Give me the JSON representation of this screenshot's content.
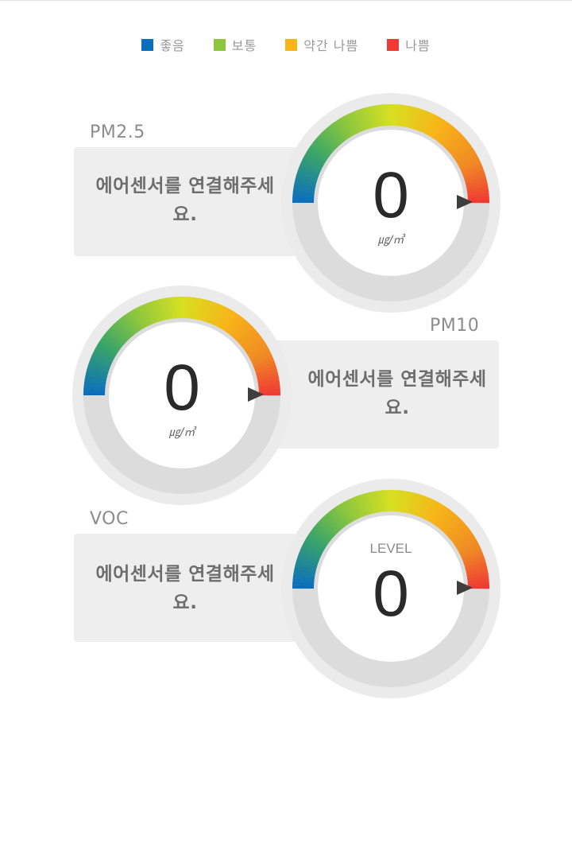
{
  "legend": [
    {
      "label": "좋음",
      "color": "#0a6ebd"
    },
    {
      "label": "보통",
      "color": "#8cc63e"
    },
    {
      "label": "약간 나쁨",
      "color": "#f8b418"
    },
    {
      "label": "나쁨",
      "color": "#ef3b33"
    }
  ],
  "sensors": [
    {
      "title": "PM2.5",
      "message": "에어센서를 연결해주세요.",
      "value": "0",
      "unit": "㎍/㎥",
      "level_label": ""
    },
    {
      "title": "PM10",
      "message": "에어센서를 연결해주세요.",
      "value": "0",
      "unit": "㎍/㎥",
      "level_label": ""
    },
    {
      "title": "VOC",
      "message": "에어센서를 연결해주세요.",
      "value": "0",
      "unit": "",
      "level_label": "LEVEL"
    }
  ],
  "gauge_colors": {
    "ring_outer": "#ebebeb",
    "track": "#dcdcdc",
    "pointer": "#3e3e3e"
  }
}
